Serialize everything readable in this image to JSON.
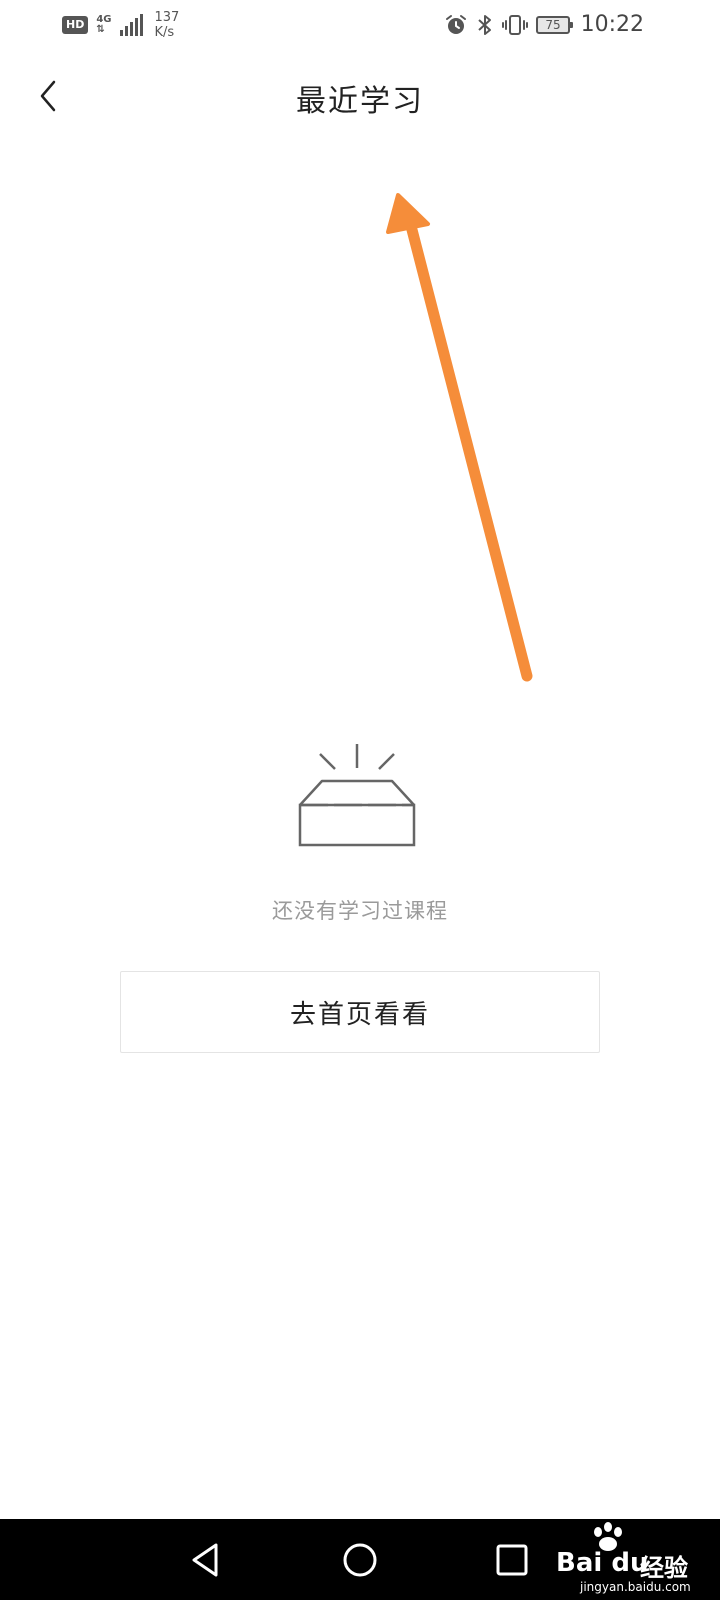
{
  "status_bar": {
    "hd": "HD",
    "network": "4G",
    "net_arrows": "⇅",
    "speed_value": "137",
    "speed_unit": "K/s",
    "battery": "75",
    "time": "10:22"
  },
  "header": {
    "title": "最近学习"
  },
  "empty_state": {
    "message": "还没有学习过课程",
    "button_label": "去首页看看"
  },
  "watermark": {
    "brand": "Bai du",
    "brand_cn": "经验",
    "url": "jingyan.baidu.com"
  },
  "colors": {
    "arrow": "#f58d3a",
    "icon_gray": "#666666",
    "text_gray": "#9a9a9a",
    "nav_bg": "#000000"
  },
  "icons": {
    "back": "chevron-left-icon",
    "empty": "open-box-icon",
    "nav_back": "triangle-back-icon",
    "nav_home": "circle-home-icon",
    "nav_recent": "square-recent-icon"
  }
}
